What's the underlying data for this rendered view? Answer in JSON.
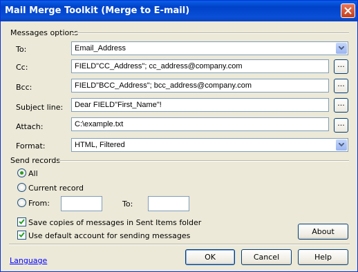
{
  "window": {
    "title": "Mail Merge Toolkit (Merge to E-mail)"
  },
  "messages_options": {
    "group_label": "Messages options",
    "to": {
      "label": "To:",
      "value": "Email_Address"
    },
    "cc": {
      "label": "Cc:",
      "value": "FIELD\"CC_Address\"; cc_address@company.com"
    },
    "bcc": {
      "label": "Bcc:",
      "value": "FIELD\"BCC_Address\"; bcc_address@company.com"
    },
    "subject": {
      "label": "Subject line:",
      "value": "Dear FIELD\"First_Name\"!"
    },
    "attach": {
      "label": "Attach:",
      "value": "C:\\example.txt"
    },
    "format": {
      "label": "Format:",
      "value": "HTML, Filtered"
    },
    "browse_label": "..."
  },
  "send_records": {
    "group_label": "Send records",
    "all_label": "All",
    "current_label": "Current record",
    "from_label": "From:",
    "to_label": "To:",
    "from_value": "",
    "to_value": "",
    "selected": "All"
  },
  "checkboxes": {
    "save_copies": {
      "label": "Save copies of messages  in Sent Items folder",
      "checked": true
    },
    "use_default": {
      "label": "Use default account for sending messages",
      "checked": true
    }
  },
  "buttons": {
    "about": "About",
    "ok": "OK",
    "cancel": "Cancel",
    "help": "Help"
  },
  "language_link": "Language",
  "colors": {
    "title_bar": "#0a4fd8",
    "dialog_bg": "#ece9d8",
    "link": "#0000ff",
    "radio_dot": "#2b9b22"
  }
}
